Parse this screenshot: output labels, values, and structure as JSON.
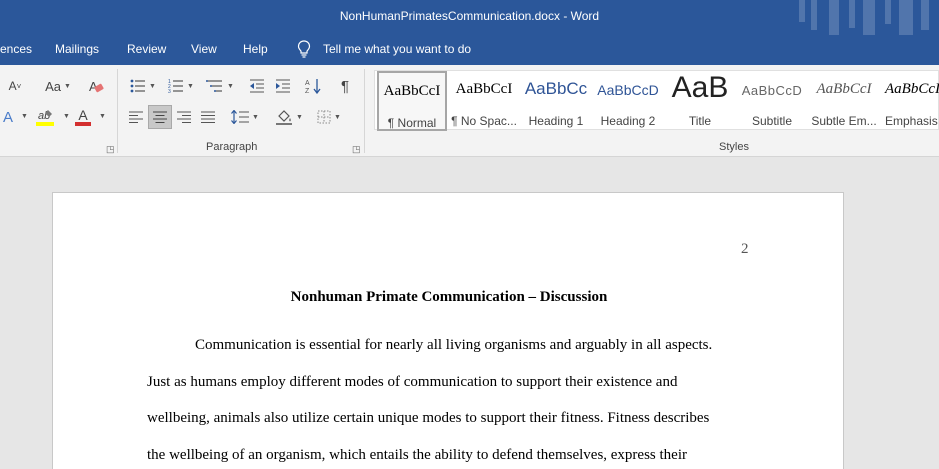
{
  "window": {
    "title": "NonHumanPrimatesCommunication.docx  -  Word"
  },
  "tabs": [
    {
      "label": "ences"
    },
    {
      "label": "Mailings"
    },
    {
      "label": "Review"
    },
    {
      "label": "View"
    },
    {
      "label": "Help"
    }
  ],
  "tell_me": {
    "text": "Tell me what you want to do",
    "icon": "lightbulb-icon"
  },
  "ribbon": {
    "font_group": {
      "change_case": "Aa",
      "shrink_font": "A",
      "text_effects": "A",
      "font_color_letter": "A",
      "font_color_bar": "#d32f2f",
      "highlight_color_bar": "#ffff00"
    },
    "paragraph_group": {
      "label": "Paragraph",
      "show_marks": "¶"
    },
    "styles_group": {
      "label": "Styles",
      "items": [
        {
          "sample": "AaBbCcI",
          "name": "¶ Normal",
          "selected": true
        },
        {
          "sample": "AaBbCcI",
          "name": "¶ No Spac..."
        },
        {
          "sample": "AaBbCc",
          "name": "Heading 1"
        },
        {
          "sample": "AaBbCcD",
          "name": "Heading 2"
        },
        {
          "sample": "AaB",
          "name": "Title"
        },
        {
          "sample": "AaBbCcD",
          "name": "Subtitle"
        },
        {
          "sample": "AaBbCcI",
          "name": "Subtle Em..."
        },
        {
          "sample": "AaBbCcI",
          "name": "Emphasis"
        }
      ]
    }
  },
  "colors": {
    "brand": "#2b579a",
    "ribbon_bg": "#f3f3f3",
    "canvas_bg": "#e6e6e6",
    "heading_blue": "#2f5496"
  },
  "document": {
    "page_number": "2",
    "title": "Nonhuman Primate Communication – Discussion",
    "lines": [
      "Communication is essential for nearly all living organisms and arguably in all aspects.",
      "Just as humans employ different modes of communication to support their existence and",
      "wellbeing, animals also utilize certain unique modes to support their fitness. Fitness describes",
      "the wellbeing of an organism, which entails the ability to defend themselves, express their"
    ]
  }
}
